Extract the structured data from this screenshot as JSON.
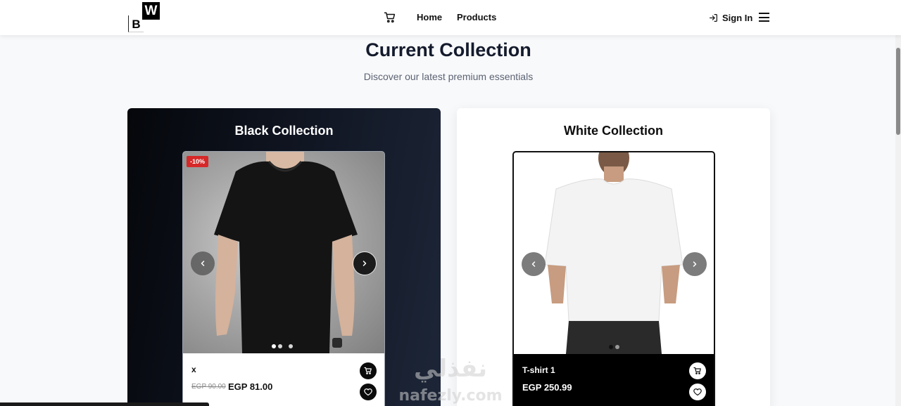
{
  "header": {
    "logo": {
      "w": "W",
      "b": "B"
    },
    "nav": {
      "home": "Home",
      "products": "Products"
    },
    "sign_in": "Sign In",
    "icons": [
      "cart-icon",
      "sign-in-icon",
      "menu-icon"
    ]
  },
  "section": {
    "title": "Current Collection",
    "subtitle": "Discover our latest premium essentials"
  },
  "collections": {
    "black": {
      "title": "Black Collection",
      "product": {
        "name": "x",
        "old_price": "EGP 90.00",
        "price": "EGP 81.00",
        "discount": "-10%",
        "slide_count": 3,
        "active_slide": 1
      }
    },
    "white": {
      "title": "White Collection",
      "product": {
        "name": "T-shirt 1",
        "price": "EGP 250.99",
        "slide_count": 2,
        "active_slide": 1
      }
    }
  },
  "watermark": {
    "arabic": "نفذلي",
    "latin": "nafezly.com"
  },
  "colors": {
    "discount_badge": "#d62828",
    "black_panel": "#0f1420",
    "white_panel": "#ffffff"
  }
}
